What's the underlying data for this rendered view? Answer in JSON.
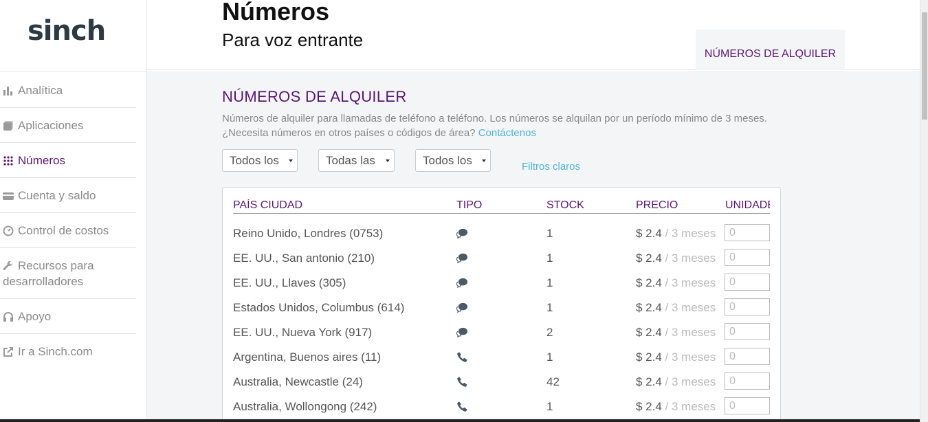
{
  "app": {
    "logo": "sinch"
  },
  "sidebar": {
    "items": [
      {
        "label": "Analítica",
        "icon": "bar-chart-icon",
        "active": false
      },
      {
        "label": "Aplicaciones",
        "icon": "apps-icon",
        "active": false
      },
      {
        "label": "Números",
        "icon": "keypad-icon",
        "active": true
      },
      {
        "label": "Cuenta y saldo",
        "icon": "credit-card-icon",
        "active": false
      },
      {
        "label": "Control de costos",
        "icon": "gauge-icon",
        "active": false
      },
      {
        "label": "Recursos para desarrolladores",
        "icon": "wrench-icon",
        "active": false
      },
      {
        "label": "Apoyo",
        "icon": "headset-icon",
        "active": false
      },
      {
        "label": "Ir a Sinch.com",
        "icon": "external-link-icon",
        "active": false
      }
    ]
  },
  "header": {
    "title": "Números",
    "subtitle": "Para voz entrante",
    "tab": "NÚMEROS DE ALQUILER"
  },
  "main": {
    "section_title": "NÚMEROS DE ALQUILER",
    "description": "Números de alquiler para llamadas de teléfono a teléfono. Los números se alquilan por un período mínimo de 3 meses. ¿Necesita números en otros países o códigos de área?",
    "contact_link": "Contáctenos",
    "filters": {
      "country": "Todos los",
      "city": "Todas las c",
      "type": "Todos los t",
      "clear": "Filtros claros"
    },
    "table": {
      "headers": {
        "country_city": "PAÍS CIUDAD",
        "type": "TIPO",
        "stock": "STOCK",
        "price": "PRECIO",
        "units": "UNIDADES"
      },
      "rows": [
        {
          "location": "Reino Unido, Londres (0753)",
          "type": "sms",
          "stock": "1",
          "price": "$ 2.4",
          "period": " / 3 meses",
          "units": "0"
        },
        {
          "location": "EE. UU., San antonio (210)",
          "type": "sms",
          "stock": "1",
          "price": "$ 2.4",
          "period": " / 3 meses",
          "units": "0"
        },
        {
          "location": "EE. UU., Llaves (305)",
          "type": "sms",
          "stock": "1",
          "price": "$ 2.4",
          "period": " / 3 meses",
          "units": "0"
        },
        {
          "location": "Estados Unidos, Columbus (614)",
          "type": "sms",
          "stock": "1",
          "price": "$ 2.4",
          "period": " / 3 meses",
          "units": "0"
        },
        {
          "location": "EE. UU., Nueva York (917)",
          "type": "sms",
          "stock": "2",
          "price": "$ 2.4",
          "period": " / 3 meses",
          "units": "0"
        },
        {
          "location": "Argentina, Buenos aires (11)",
          "type": "voice",
          "stock": "1",
          "price": "$ 2.4",
          "period": " / 3 meses",
          "units": "0"
        },
        {
          "location": "Australia, Newcastle (24)",
          "type": "voice",
          "stock": "42",
          "price": "$ 2.4",
          "period": " / 3 meses",
          "units": "0"
        },
        {
          "location": "Australia, Wollongong (242)",
          "type": "voice",
          "stock": "1",
          "price": "$ 2.4",
          "period": " / 3 meses",
          "units": "0"
        }
      ]
    }
  },
  "colors": {
    "accent": "#5a1773",
    "link": "#4fb3d9",
    "background": "#f4f5f7"
  }
}
